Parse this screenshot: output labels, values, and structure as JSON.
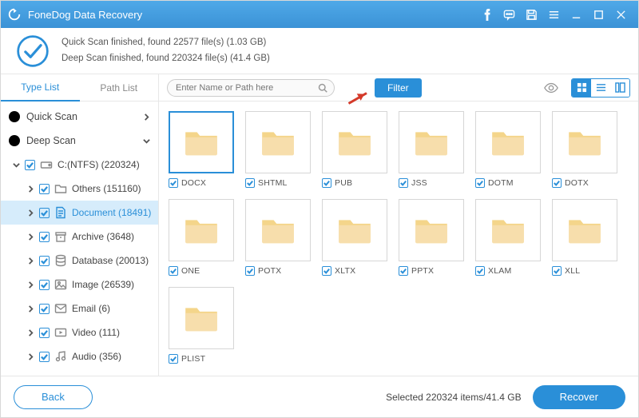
{
  "app_title": "FoneDog Data Recovery",
  "summary": {
    "line1": "Quick Scan finished, found 22577 file(s) (1.03 GB)",
    "line2": "Deep Scan finished, found 220324 file(s) (41.4 GB)"
  },
  "sidebar": {
    "tabs": {
      "type_list": "Type List",
      "path_list": "Path List"
    },
    "quick_scan": "Quick Scan",
    "deep_scan": "Deep Scan",
    "drive_label": "C:(NTFS) (220324)",
    "categories": [
      {
        "label": "Others (151160)",
        "icon": "folder"
      },
      {
        "label": "Document (18491)",
        "icon": "document",
        "selected": true
      },
      {
        "label": "Archive (3648)",
        "icon": "archive"
      },
      {
        "label": "Database (20013)",
        "icon": "database"
      },
      {
        "label": "Image (26539)",
        "icon": "image"
      },
      {
        "label": "Email (6)",
        "icon": "email"
      },
      {
        "label": "Video (111)",
        "icon": "video"
      },
      {
        "label": "Audio (356)",
        "icon": "audio"
      }
    ]
  },
  "toolbar": {
    "search_placeholder": "Enter Name or Path here",
    "filter_label": "Filter"
  },
  "grid_items": [
    {
      "name": "DOCX",
      "selected": true
    },
    {
      "name": "SHTML"
    },
    {
      "name": "PUB"
    },
    {
      "name": "JSS"
    },
    {
      "name": "DOTM"
    },
    {
      "name": "DOTX"
    },
    {
      "name": "ONE"
    },
    {
      "name": "POTX"
    },
    {
      "name": "XLTX"
    },
    {
      "name": "PPTX"
    },
    {
      "name": "XLAM"
    },
    {
      "name": "XLL"
    },
    {
      "name": "PLIST"
    }
  ],
  "footer": {
    "back_label": "Back",
    "selected_text": "Selected 220324 items/41.4 GB",
    "recover_label": "Recover"
  }
}
